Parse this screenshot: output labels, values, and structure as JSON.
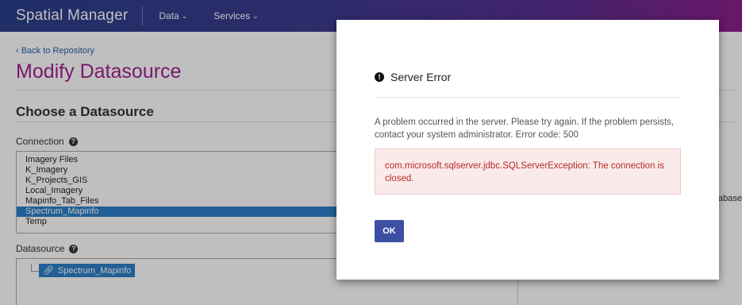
{
  "nav": {
    "brand": "Spatial Manager",
    "items": [
      {
        "label": "Data"
      },
      {
        "label": "Services"
      }
    ]
  },
  "page": {
    "back_link": "‹ Back to Repository",
    "title": "Modify Datasource",
    "section_title": "Choose a Datasource",
    "connection_label": "Connection",
    "connections": [
      {
        "label": "Imagery Files",
        "selected": false
      },
      {
        "label": "K_Imagery",
        "selected": false
      },
      {
        "label": "K_Projects_GIS",
        "selected": false
      },
      {
        "label": "Local_Imagery",
        "selected": false
      },
      {
        "label": "Mapinfo_Tab_Files",
        "selected": false
      },
      {
        "label": "Spectrum_Mapinfo",
        "selected": true
      },
      {
        "label": "Temp",
        "selected": false
      }
    ],
    "datasource_label": "Datasource",
    "datasource_node": "Spectrum_Mapinfo",
    "right_fragment": "abase"
  },
  "modal": {
    "title": "Server Error",
    "message": "A problem occurred in the server. Please try again. If the problem persists, contact your system administrator. Error code: 500",
    "error_detail": "com.microsoft.sqlserver.jdbc.SQLServerException: The connection is closed.",
    "ok_label": "OK"
  },
  "icons": {
    "help": "question-circle-icon",
    "error": "exclamation-circle-icon",
    "link": "link-icon",
    "caret": "chevron-down-icon"
  },
  "colors": {
    "title_accent": "#a4208e",
    "selection": "#2d7fc8",
    "ok_button": "#3d4fa3",
    "alert_text": "#b52b27",
    "alert_bg": "#fbeaea"
  }
}
